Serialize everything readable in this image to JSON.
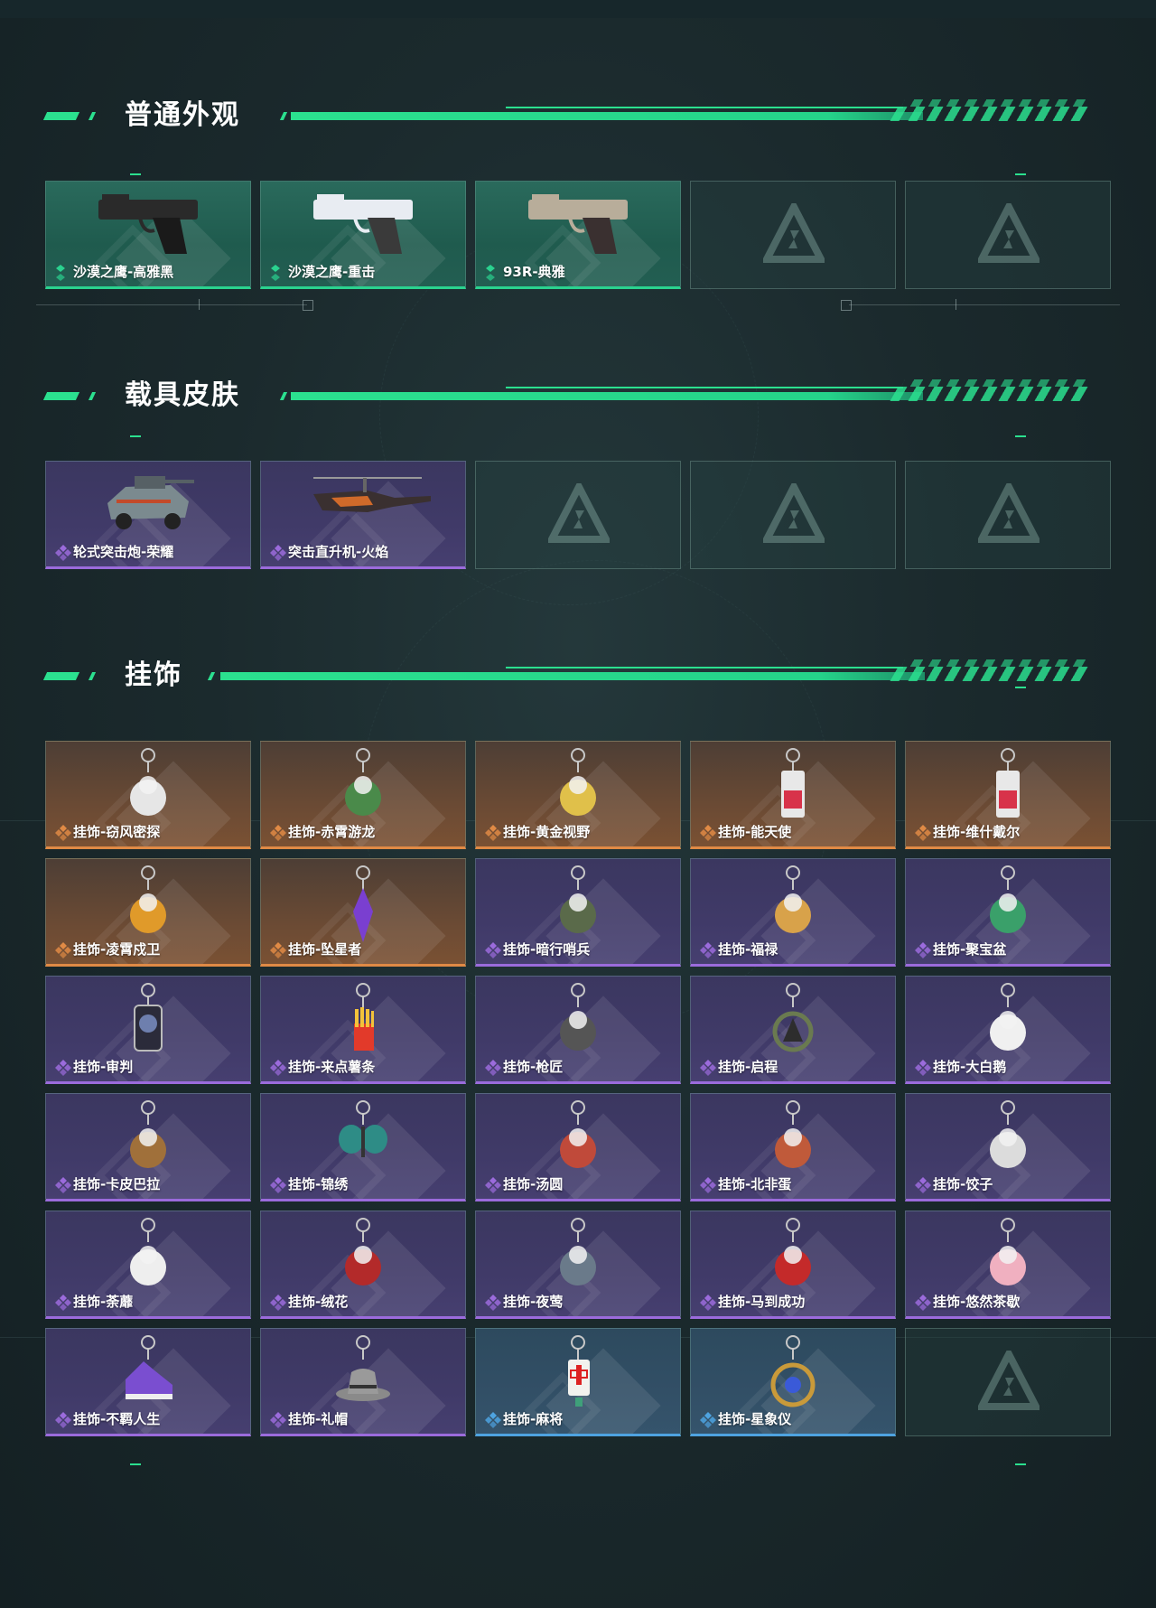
{
  "colors": {
    "accent_green": "#2be08f",
    "rarity_green": "#2ad28f",
    "rarity_purple": "#9b6bdc",
    "rarity_orange": "#e08a45",
    "rarity_blue": "#4ea3e0"
  },
  "sections": [
    {
      "title": "普通外观",
      "items": [
        {
          "name": "沙漠之鹰-高雅黑",
          "rarity": "green",
          "icon": "black-desert-eagle-pistol-icon"
        },
        {
          "name": "沙漠之鹰-重击",
          "rarity": "green",
          "icon": "white-blue-desert-eagle-pistol-icon"
        },
        {
          "name": "93R-典雅",
          "rarity": "green",
          "icon": "93r-pistol-icon"
        },
        {
          "empty": true
        },
        {
          "empty": true
        }
      ]
    },
    {
      "title": "载具皮肤",
      "items": [
        {
          "name": "轮式突击炮-荣耀",
          "rarity": "purple",
          "icon": "armored-vehicle-icon"
        },
        {
          "name": "突击直升机-火焰",
          "rarity": "purple",
          "icon": "attack-helicopter-icon"
        },
        {
          "empty": true
        },
        {
          "empty": true
        },
        {
          "empty": true
        }
      ]
    },
    {
      "title": "挂饰",
      "items": [
        {
          "name": "挂饰-窃风密探",
          "rarity": "orange",
          "icon": "bunny-charm-icon"
        },
        {
          "name": "挂饰-赤霄游龙",
          "rarity": "orange",
          "icon": "dragon-charm-icon"
        },
        {
          "name": "挂饰-黄金视野",
          "rarity": "orange",
          "icon": "golden-figure-charm-icon"
        },
        {
          "name": "挂饰-能天使",
          "rarity": "orange",
          "icon": "card-charm-icon"
        },
        {
          "name": "挂饰-维什戴尔",
          "rarity": "orange",
          "icon": "card-charm-icon"
        },
        {
          "name": "挂饰-凌霄戍卫",
          "rarity": "orange",
          "icon": "bird-charm-icon"
        },
        {
          "name": "挂饰-坠星者",
          "rarity": "orange",
          "icon": "purple-crystal-charm-icon"
        },
        {
          "name": "挂饰-暗行哨兵",
          "rarity": "purple",
          "icon": "soldier-charm-icon"
        },
        {
          "name": "挂饰-福禄",
          "rarity": "purple",
          "icon": "gourd-charm-icon"
        },
        {
          "name": "挂饰-聚宝盆",
          "rarity": "purple",
          "icon": "treasure-bowl-charm-icon"
        },
        {
          "name": "挂饰-审判",
          "rarity": "purple",
          "icon": "tag-charm-icon"
        },
        {
          "name": "挂饰-来点薯条",
          "rarity": "purple",
          "icon": "fries-charm-icon"
        },
        {
          "name": "挂饰-枪匠",
          "rarity": "purple",
          "icon": "vest-charm-icon"
        },
        {
          "name": "挂饰-启程",
          "rarity": "purple",
          "icon": "ring-charm-icon"
        },
        {
          "name": "挂饰-大白鹅",
          "rarity": "purple",
          "icon": "goose-charm-icon"
        },
        {
          "name": "挂饰-卡皮巴拉",
          "rarity": "purple",
          "icon": "capybara-charm-icon"
        },
        {
          "name": "挂饰-锦绣",
          "rarity": "purple",
          "icon": "butterfly-charm-icon"
        },
        {
          "name": "挂饰-汤圆",
          "rarity": "purple",
          "icon": "bowl-charm-icon"
        },
        {
          "name": "挂饰-北非蛋",
          "rarity": "purple",
          "icon": "egg-pan-charm-icon"
        },
        {
          "name": "挂饰-饺子",
          "rarity": "purple",
          "icon": "dumpling-charm-icon"
        },
        {
          "name": "挂饰-荼蘼",
          "rarity": "purple",
          "icon": "white-flower-charm-icon"
        },
        {
          "name": "挂饰-绒花",
          "rarity": "purple",
          "icon": "red-flower-charm-icon"
        },
        {
          "name": "挂饰-夜莺",
          "rarity": "purple",
          "icon": "nightingale-charm-icon"
        },
        {
          "name": "挂饰-马到成功",
          "rarity": "purple",
          "icon": "red-horse-charm-icon"
        },
        {
          "name": "挂饰-悠然茶歇",
          "rarity": "purple",
          "icon": "cupcake-charm-icon"
        },
        {
          "name": "挂饰-不羁人生",
          "rarity": "purple",
          "icon": "sneaker-charm-icon"
        },
        {
          "name": "挂饰-礼帽",
          "rarity": "purple",
          "icon": "hat-charm-icon"
        },
        {
          "name": "挂饰-麻将",
          "rarity": "blue",
          "icon": "mahjong-tile-charm-icon"
        },
        {
          "name": "挂饰-星象仪",
          "rarity": "blue",
          "icon": "astrolabe-charm-icon"
        },
        {
          "empty": true
        }
      ]
    }
  ]
}
